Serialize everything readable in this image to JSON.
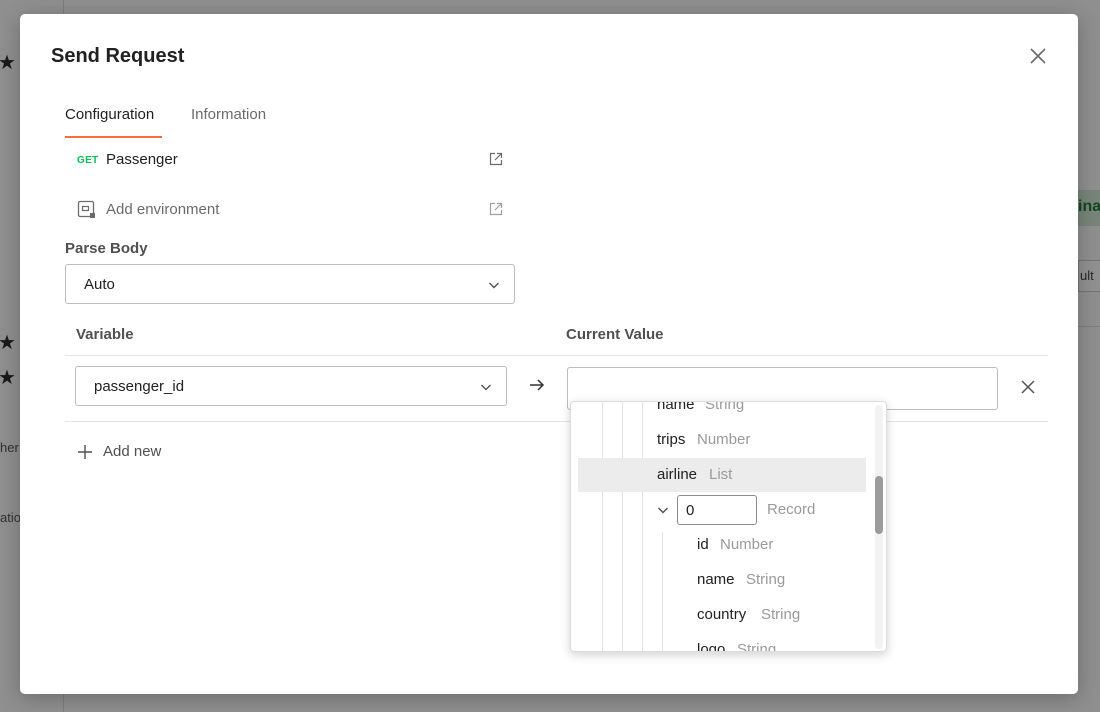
{
  "background": {
    "pill_text": "ina",
    "button_text": "ult",
    "side_texts": [
      "her",
      "atio"
    ]
  },
  "modal": {
    "title": "Send Request",
    "tabs": [
      {
        "label": "Configuration",
        "active": true
      },
      {
        "label": "Information",
        "active": false
      }
    ],
    "request": {
      "method": "GET",
      "name": "Passenger"
    },
    "environment": {
      "label": "Add environment"
    },
    "parse_body": {
      "label": "Parse Body",
      "selected": "Auto"
    },
    "table": {
      "variable_header": "Variable",
      "value_header": "Current Value",
      "rows": [
        {
          "variable": "passenger_id",
          "current_value": ""
        }
      ]
    },
    "add_new_label": "Add new"
  },
  "dropdown": {
    "items": [
      {
        "key": "name",
        "type": "String",
        "depth": 1
      },
      {
        "key": "trips",
        "type": "Number",
        "depth": 1
      },
      {
        "key": "airline",
        "type": "List",
        "depth": 1,
        "highlighted": true
      },
      {
        "key": "0",
        "type": "Record",
        "depth": 2,
        "is_index_input": true,
        "expanded": true
      },
      {
        "key": "id",
        "type": "Number",
        "depth": 3
      },
      {
        "key": "name",
        "type": "String",
        "depth": 3
      },
      {
        "key": "country",
        "type": "String",
        "depth": 3
      },
      {
        "key": "logo",
        "type": "String",
        "depth": 3
      }
    ]
  },
  "colors": {
    "accent": "#ff6c37",
    "method_get": "#0cbb52",
    "hover_row": "#ececec"
  }
}
